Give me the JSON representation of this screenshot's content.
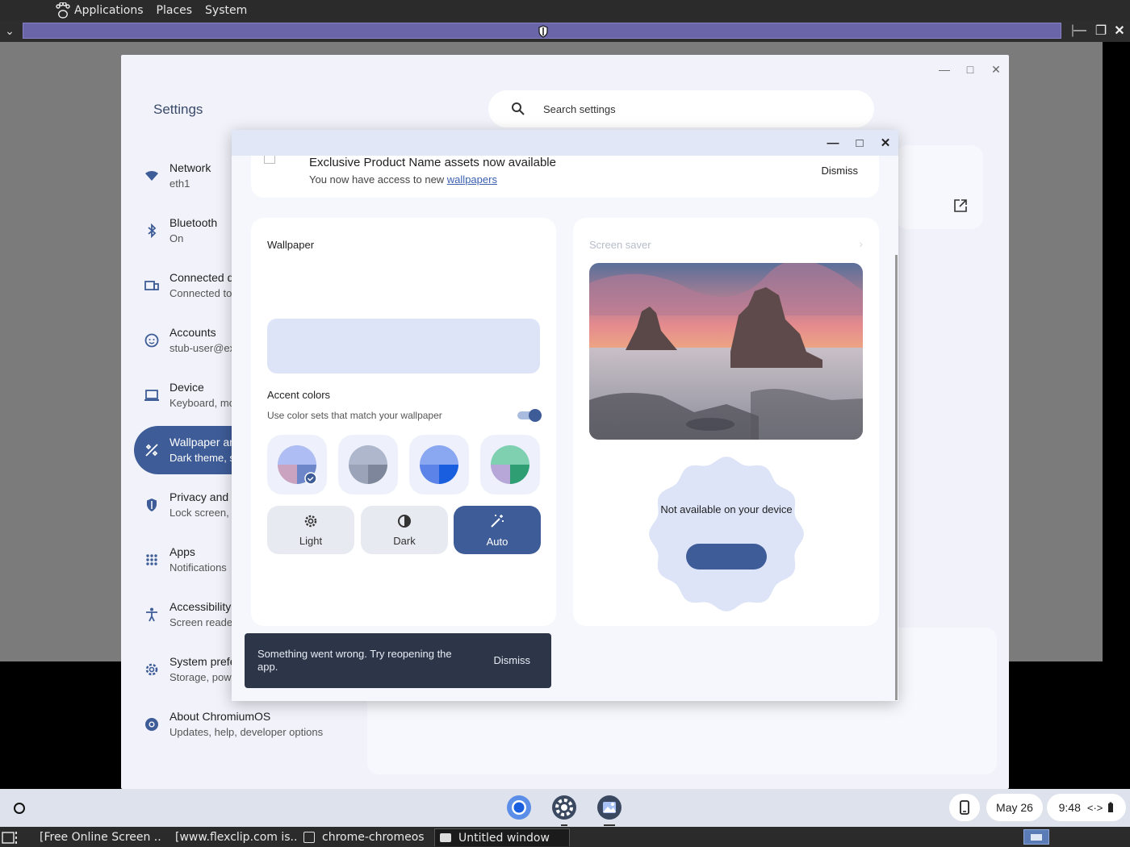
{
  "gnome_panel": {
    "menus": [
      "Applications",
      "Places",
      "System"
    ]
  },
  "settings": {
    "title": "Settings",
    "search_placeholder": "Search settings",
    "nav": [
      {
        "label": "Network",
        "sub": "eth1",
        "icon": "wifi-icon"
      },
      {
        "label": "Bluetooth",
        "sub": "On",
        "icon": "bluetooth-icon"
      },
      {
        "label": "Connected d",
        "sub": "Connected to",
        "icon": "connected-devices-icon"
      },
      {
        "label": "Accounts",
        "sub": "stub-user@ex",
        "icon": "account-icon"
      },
      {
        "label": "Device",
        "sub": "Keyboard, mo",
        "icon": "laptop-icon"
      },
      {
        "label": "Wallpaper ar",
        "sub": "Dark theme, s",
        "icon": "palette-icon"
      },
      {
        "label": "Privacy and",
        "sub": "Lock screen,",
        "icon": "shield-icon"
      },
      {
        "label": "Apps",
        "sub": "Notifications",
        "icon": "apps-grid-icon"
      },
      {
        "label": "Accessibility",
        "sub": "Screen reade",
        "icon": "accessibility-icon"
      },
      {
        "label": "System prefe",
        "sub": "Storage, pow",
        "icon": "gear-icon"
      },
      {
        "label": "About ChromiumOS",
        "sub": "Updates, help, developer options",
        "icon": "chromium-icon"
      }
    ]
  },
  "wallpaper_app": {
    "banner": {
      "title": "Exclusive Product Name assets now available",
      "text": "You now have access to new ",
      "link": "wallpapers",
      "dismiss": "Dismiss"
    },
    "wallpaper_heading": "Wallpaper",
    "accent_heading": "Accent colors",
    "accent_sub": "Use color sets that match your wallpaper",
    "accent_toggle_on": true,
    "modes": [
      "Light",
      "Dark",
      "Auto"
    ],
    "selected_mode": "Auto",
    "screensaver_heading": "Screen saver",
    "unavailable": "Not available on your device",
    "toast": {
      "message": "Something went wrong. Try reopening the app.",
      "dismiss": "Dismiss"
    },
    "colors": {
      "primary": "#3e5c97",
      "accent_light": "#dde4f8"
    }
  },
  "shelf": {
    "date": "May 26",
    "time": "9:48"
  },
  "taskbar": {
    "tasks": [
      "[Free Online Screen ...",
      "[www.flexclip.com is...",
      "chrome-chromeos",
      "Untitled window"
    ]
  }
}
